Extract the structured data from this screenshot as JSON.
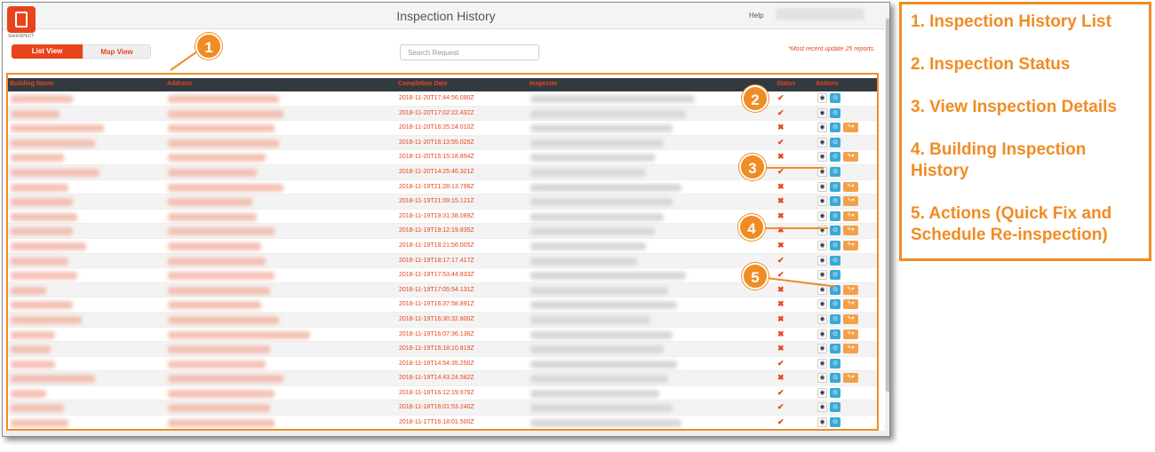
{
  "app": {
    "title": "Inspection History",
    "help": "Help",
    "logo_text": "SiteInSPECT"
  },
  "toolbar": {
    "list_view": "List View",
    "map_view": "Map View",
    "search_placeholder": "Search Request",
    "recent_note": "*Most recent update 25 reports."
  },
  "table": {
    "columns": [
      "Building Name",
      "Address",
      "Completion Date",
      "Inspector",
      "Status",
      "Actions"
    ],
    "rows": [
      {
        "date": "2018-11-20T17:44:56.090Z",
        "status": "pass",
        "fix": false
      },
      {
        "date": "2018-11-20T17:02:22.432Z",
        "status": "pass",
        "fix": false
      },
      {
        "date": "2018-11-20T16:25:24.010Z",
        "status": "fail",
        "fix": true
      },
      {
        "date": "2018-11-20T16:13:55.025Z",
        "status": "pass",
        "fix": false
      },
      {
        "date": "2018-11-20T15:15:18.894Z",
        "status": "fail",
        "fix": true
      },
      {
        "date": "2018-11-20T14:25:46.321Z",
        "status": "pass",
        "fix": false
      },
      {
        "date": "2018-11-19T21:28:13.796Z",
        "status": "fail",
        "fix": true
      },
      {
        "date": "2018-11-19T21:09:15.121Z",
        "status": "fail",
        "fix": true
      },
      {
        "date": "2018-11-19T19:31:38.089Z",
        "status": "fail",
        "fix": true
      },
      {
        "date": "2018-11-19T19:12:19.835Z",
        "status": "fail",
        "fix": true
      },
      {
        "date": "2018-11-19T18:21:56.005Z",
        "status": "fail",
        "fix": true
      },
      {
        "date": "2018-11-19T18:17:17.417Z",
        "status": "pass",
        "fix": false
      },
      {
        "date": "2018-11-19T17:53:44.833Z",
        "status": "pass",
        "fix": false
      },
      {
        "date": "2018-11-19T17:05:54.131Z",
        "status": "fail",
        "fix": true
      },
      {
        "date": "2018-11-19T16:37:58.891Z",
        "status": "fail",
        "fix": true
      },
      {
        "date": "2018-11-19T16:30:32.800Z",
        "status": "fail",
        "fix": true
      },
      {
        "date": "2018-11-19T16:07:36.136Z",
        "status": "fail",
        "fix": true
      },
      {
        "date": "2018-11-19T15:18:10.819Z",
        "status": "fail",
        "fix": true
      },
      {
        "date": "2018-11-19T14:54:35.250Z",
        "status": "pass",
        "fix": false
      },
      {
        "date": "2018-11-19T14:43:24.582Z",
        "status": "fail",
        "fix": true
      },
      {
        "date": "2018-11-18T16:12:19.979Z",
        "status": "pass",
        "fix": false
      },
      {
        "date": "2018-11-18T16:01:53.240Z",
        "status": "pass",
        "fix": false
      },
      {
        "date": "2018-11-17T16:18:01.500Z",
        "status": "pass",
        "fix": false
      }
    ]
  },
  "icons": {
    "pass": "✔",
    "fail": "✖",
    "eye": "◉",
    "view": "⊙",
    "fix": "✎▾"
  },
  "callouts": [
    "1",
    "2",
    "3",
    "4",
    "5"
  ],
  "legend": [
    "1. Inspection History List",
    "2. Inspection Status",
    "3. View Inspection Details",
    "4. Building Inspection History",
    "5. Actions (Quick Fix and Schedule Re-inspection)"
  ],
  "colors": {
    "accent": "#e8441b",
    "callout": "#f08c24",
    "header_bg": "#323a40",
    "view_button": "#3aa9d6",
    "fix_button": "#f4a04a"
  }
}
